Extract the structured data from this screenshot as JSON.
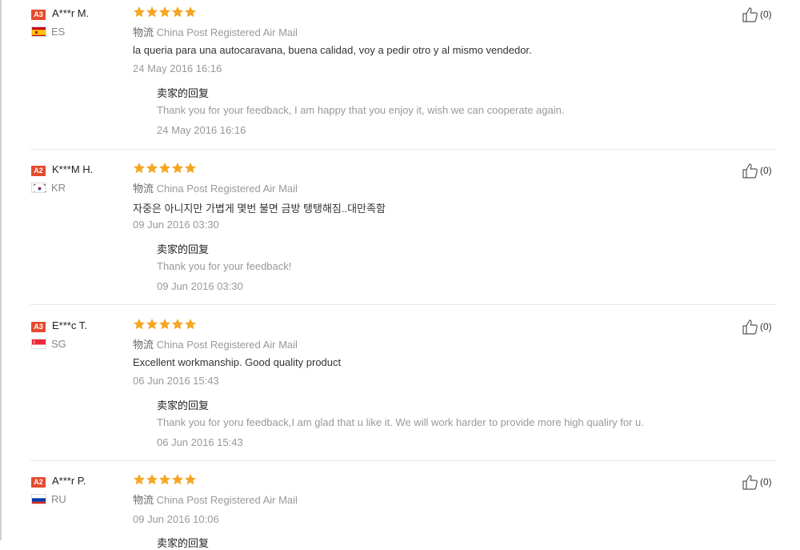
{
  "reviews": [
    {
      "level": "A3",
      "name": "A***r M.",
      "country": "ES",
      "flag_colors": [
        "#c60b1e",
        "#ffc400",
        "#c60b1e"
      ],
      "rating": 5,
      "shipping_label": "物流",
      "shipping_method": "China Post Registered Air Mail",
      "comment": "la queria para una autocaravana, buena calidad, voy a pedir otro y al mismo vendedor.",
      "date": "24 May 2016 16:16",
      "reply_title": "卖家的回复",
      "reply_text": "Thank you for your feedback, I am happy that you enjoy it, wish we can cooperate again.",
      "reply_date": "24 May 2016 16:16",
      "useful_count": "(0)"
    },
    {
      "level": "A2",
      "name": "K***M H.",
      "country": "KR",
      "flag_colors": [
        "#ffffff",
        "#cd2e3a",
        "#0047a0"
      ],
      "rating": 5,
      "shipping_label": "物流",
      "shipping_method": "China Post Registered Air Mail",
      "comment": "자중은 아니지만 가볍게 몇번 불면 금방 탱탱해짐..대만족함",
      "date": "09 Jun 2016 03:30",
      "reply_title": "卖家的回复",
      "reply_text": "Thank you for your feedback!",
      "reply_date": "09 Jun 2016 03:30",
      "useful_count": "(0)"
    },
    {
      "level": "A3",
      "name": "E***c T.",
      "country": "SG",
      "flag_colors": [
        "#ed2939",
        "#ffffff"
      ],
      "rating": 5,
      "shipping_label": "物流",
      "shipping_method": "China Post Registered Air Mail",
      "comment": "Excellent workmanship. Good quality product",
      "date": "06 Jun 2016 15:43",
      "reply_title": "卖家的回复",
      "reply_text": "Thank you for yoru feedback,I am glad that u like it. We will work harder to provide more high qualiry for u.",
      "reply_date": "06 Jun 2016 15:43",
      "useful_count": "(0)"
    },
    {
      "level": "A2",
      "name": "A***r P.",
      "country": "RU",
      "flag_colors": [
        "#ffffff",
        "#0039a6",
        "#d52b1e"
      ],
      "rating": 5,
      "shipping_label": "物流",
      "shipping_method": "China Post Registered Air Mail",
      "comment": "",
      "date": "09 Jun 2016 10:06",
      "reply_title": "卖家的回复",
      "reply_text": "",
      "reply_date": "",
      "useful_count": "(0)"
    }
  ],
  "colors": {
    "star": "#f5a623",
    "badge": "#e64a2e",
    "muted_text": "#999999",
    "body_text": "#333333"
  },
  "icons": {
    "rating": "star-icon",
    "useful": "thumbs-up-icon"
  }
}
